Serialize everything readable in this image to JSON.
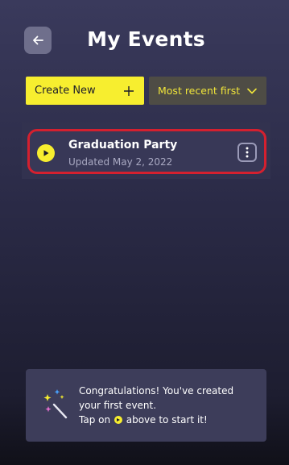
{
  "header": {
    "title": "My Events",
    "back_icon": "arrow-left-icon"
  },
  "toolbar": {
    "create_label": "Create New",
    "create_icon": "plus-icon",
    "sort_selected": "Most recent first",
    "sort_icon": "chevron-down-icon"
  },
  "events": [
    {
      "name": "Graduation Party",
      "updated": "Updated May 2, 2022",
      "play_icon": "play-icon",
      "more_icon": "more-vertical-icon"
    }
  ],
  "toast": {
    "line1": "Congratulations! You've created",
    "line2": "your first event.",
    "line3_prefix": "Tap on",
    "line3_suffix": "above to start it!",
    "icon": "sparkle-wand-icon"
  },
  "colors": {
    "accent_yellow": "#f7ee2f",
    "highlight_red": "#d4202f",
    "background": "#2a2a46"
  }
}
